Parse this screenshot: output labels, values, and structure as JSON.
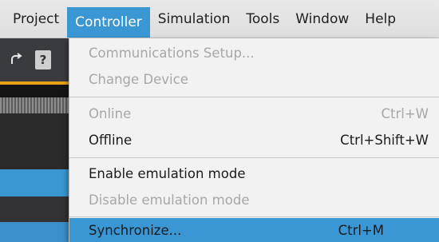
{
  "menubar": {
    "items": [
      {
        "label": "Project",
        "active": false
      },
      {
        "label": "Controller",
        "active": true
      },
      {
        "label": "Simulation",
        "active": false
      },
      {
        "label": "Tools",
        "active": false
      },
      {
        "label": "Window",
        "active": false
      },
      {
        "label": "Help",
        "active": false
      }
    ]
  },
  "toolbar": {
    "redo_icon": "redo-icon",
    "help_icon": "help-icon",
    "help_glyph": "?"
  },
  "controller_menu": {
    "items": [
      {
        "label": "Communications Setup...",
        "shortcut": "",
        "state": "disabled"
      },
      {
        "label": "Change Device",
        "shortcut": "",
        "state": "disabled"
      },
      {
        "label": "Online",
        "shortcut": "Ctrl+W",
        "state": "disabled"
      },
      {
        "label": "Offline",
        "shortcut": "Ctrl+Shift+W",
        "state": "enabled"
      },
      {
        "label": "Enable emulation mode",
        "shortcut": "",
        "state": "enabled"
      },
      {
        "label": "Disable emulation mode",
        "shortcut": "",
        "state": "disabled"
      },
      {
        "label": "Synchronize...",
        "shortcut": "Ctrl+M",
        "state": "highlighted"
      }
    ]
  },
  "colors": {
    "accent": "#3b97d3",
    "disabled_text": "#a7a7a7",
    "toolbar_bg": "#3a3b3f",
    "orange_line": "#e8a219"
  }
}
